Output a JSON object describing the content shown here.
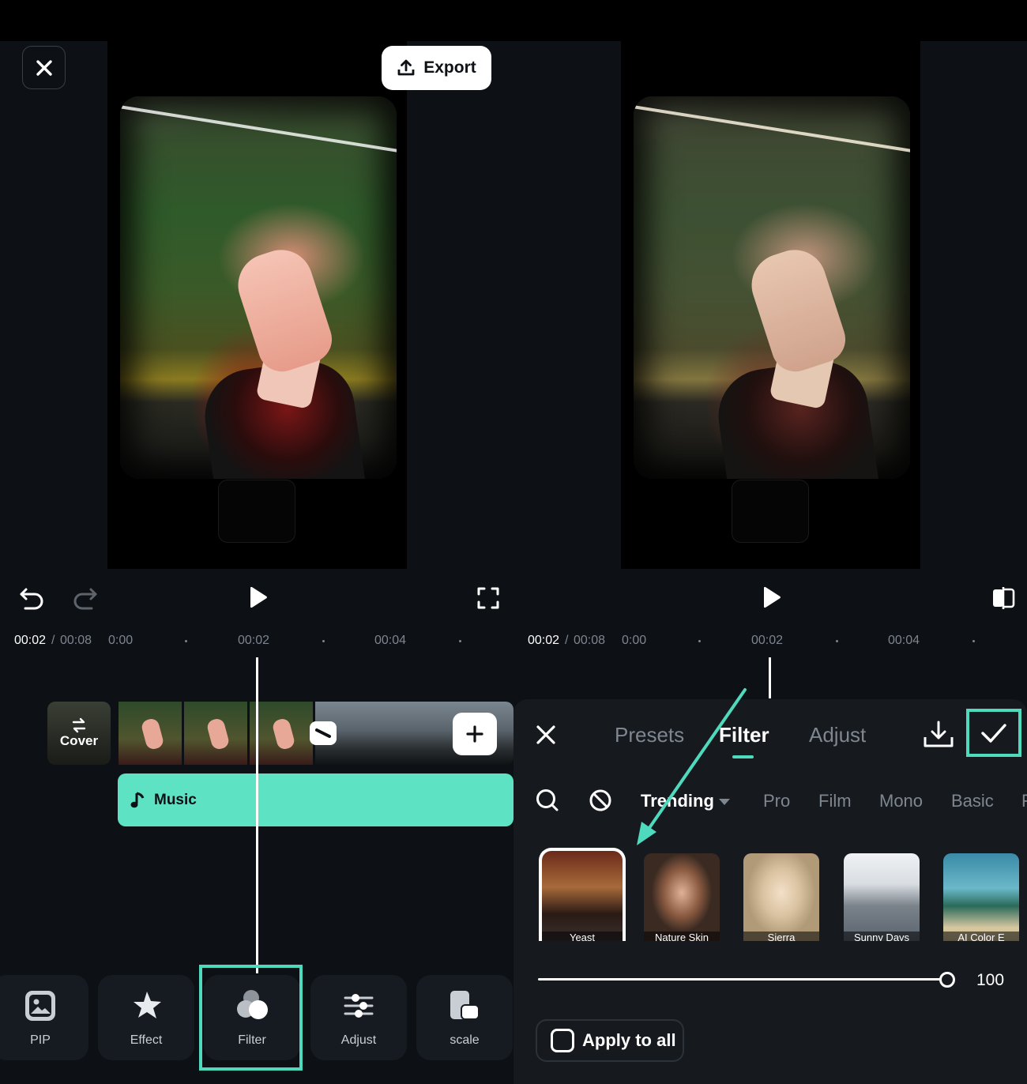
{
  "header": {
    "export_label": "Export"
  },
  "timeline": {
    "current_time": "00:02",
    "separator": "/",
    "total_time": "00:08",
    "ticks": [
      "0:00",
      "00:02",
      "00:04"
    ],
    "cover_label": "Cover",
    "music_label": "Music"
  },
  "toolbar": {
    "items": [
      {
        "label": "PIP",
        "icon": "pip-icon"
      },
      {
        "label": "Effect",
        "icon": "effect-star-icon"
      },
      {
        "label": "Filter",
        "icon": "filter-circles-icon"
      },
      {
        "label": "Adjust",
        "icon": "adjust-sliders-icon"
      },
      {
        "label": "scale",
        "icon": "scale-icon"
      }
    ],
    "highlighted": "Filter"
  },
  "filter_panel": {
    "tabs": [
      "Presets",
      "Filter",
      "Adjust"
    ],
    "active_tab": "Filter",
    "categories": [
      "Trending",
      "Pro",
      "Film",
      "Mono",
      "Basic",
      "F"
    ],
    "active_category": "Trending",
    "filters": [
      {
        "label": "Yeast",
        "selected": true
      },
      {
        "label": "Nature Skin"
      },
      {
        "label": "Sierra"
      },
      {
        "label": "Sunny Days"
      },
      {
        "label": "AI Color E"
      }
    ],
    "intensity": "100",
    "apply_to_all": "Apply to all"
  },
  "colors": {
    "accent": "#4fd9bd",
    "music_track": "#5de3c4",
    "background": "#0d1014"
  }
}
